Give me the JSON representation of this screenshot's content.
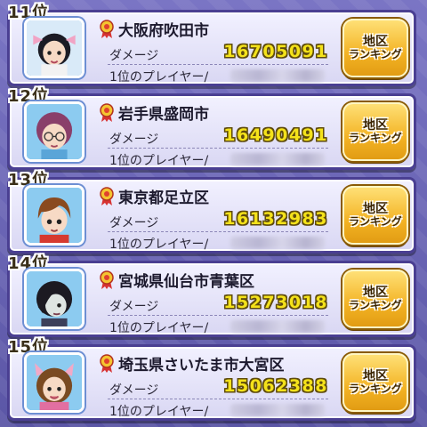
{
  "label_damage": "ダメージ",
  "label_player": "1位のプレイヤー/",
  "button_line1": "地区",
  "button_line2": "ランキング",
  "entries": [
    {
      "rank": "11位",
      "region": "大阪府吹田市",
      "damage": "16705091",
      "avatar": "girl-with-bow"
    },
    {
      "rank": "12位",
      "region": "岩手県盛岡市",
      "damage": "16490491",
      "avatar": "girl-with-glasses"
    },
    {
      "rank": "13位",
      "region": "東京都足立区",
      "damage": "16132983",
      "avatar": "boy-brown-hair"
    },
    {
      "rank": "14位",
      "region": "宮城県仙台市青葉区",
      "damage": "15273018",
      "avatar": "dark-haired-youkai"
    },
    {
      "rank": "15位",
      "region": "埼玉県さいたま市大宮区",
      "damage": "15062388",
      "avatar": "cat-ear-girl"
    }
  ],
  "colors": {
    "background": "#6b66b3",
    "card": "#e7e5fa",
    "damage_text": "#f4e21a",
    "button": "#f3b324"
  }
}
